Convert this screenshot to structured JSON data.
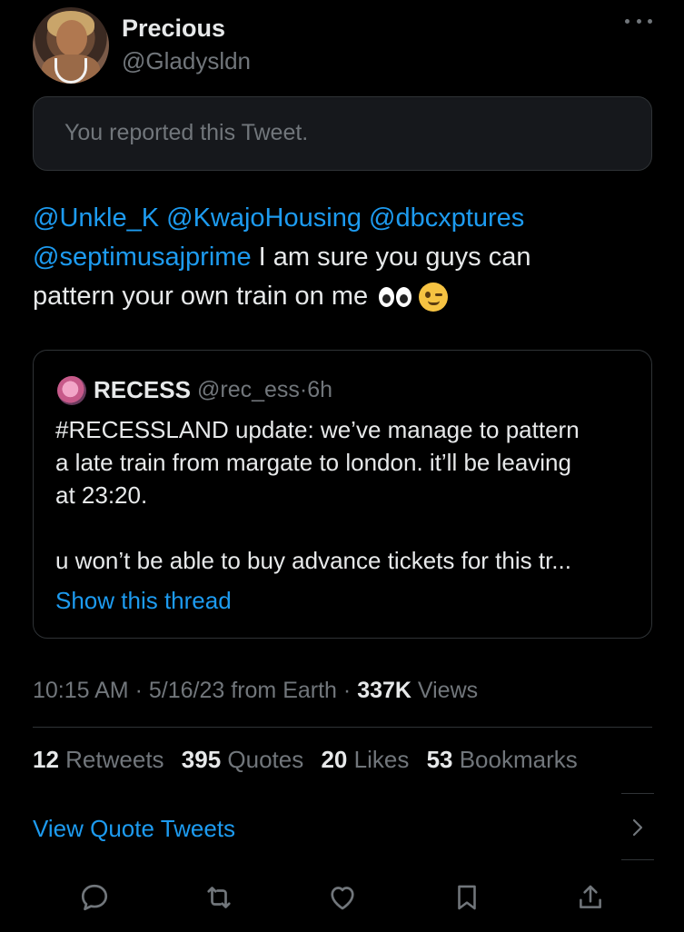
{
  "author": {
    "name": "Precious",
    "handle": "@Gladysldn"
  },
  "report_notice": "You reported this Tweet.",
  "tweet": {
    "mentions": [
      "@Unkle_K",
      "@KwajoHousing",
      "@dbcxptures",
      "@septimusajprime"
    ],
    "text_line2": " I am sure you guys can",
    "text_line3": "pattern your own train on me",
    "emojis": [
      "eyes",
      "winking-face"
    ]
  },
  "quoted_tweet": {
    "name": "RECESS",
    "handle": "@rec_ess",
    "separator": "·",
    "time": "6h",
    "body_line1": "#RECESSLAND update: we’ve manage to pattern",
    "body_line2": "a late train from margate to london. it’ll be leaving",
    "body_line3": "at 23:20.",
    "body_line4": " u won’t be able to buy advance tickets for this tr...",
    "show_thread": "Show this thread"
  },
  "meta": {
    "time": "10:15 AM",
    "date": "5/16/23",
    "source": "from Earth",
    "separator": "·",
    "views_count": "337K",
    "views_label": "Views"
  },
  "stats": {
    "retweets_count": "12",
    "retweets_label": "Retweets",
    "quotes_count": "395",
    "quotes_label": "Quotes",
    "likes_count": "20",
    "likes_label": "Likes",
    "bookmarks_count": "53",
    "bookmarks_label": "Bookmarks"
  },
  "view_quote_tweets": "View Quote Tweets",
  "actions": [
    "reply-icon",
    "retweet-icon",
    "like-icon",
    "bookmark-icon",
    "share-icon"
  ],
  "colors": {
    "background": "#000000",
    "text": "#e7e9ea",
    "secondary_text": "#71767b",
    "link": "#1d9bf0",
    "border": "#2f3336"
  }
}
